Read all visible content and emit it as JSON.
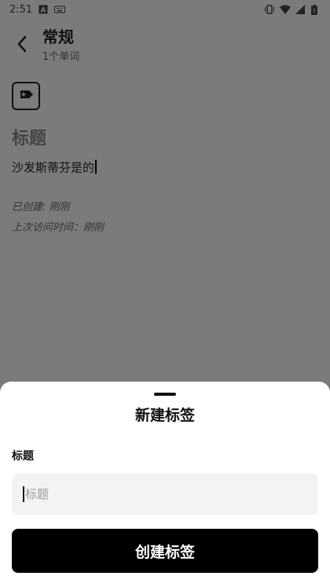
{
  "status_bar": {
    "time": "2:51",
    "icons": [
      "notification-a-icon",
      "keyboard-icon",
      "vibrate-icon",
      "wifi-icon",
      "signal-icon",
      "battery-icon"
    ]
  },
  "header": {
    "title": "常规",
    "subtitle": "1个单词",
    "back_icon": "back-chevron-icon"
  },
  "note": {
    "icon": "note-type-icon",
    "title": "标题",
    "body": "沙发斯蒂芬是的",
    "created": "已创建: 刚刚",
    "last_visited": "上次访问时间：刚刚"
  },
  "sheet": {
    "title": "新建标签",
    "field_label": "标题",
    "input_placeholder": "标题",
    "input_value": "",
    "primary_button": "创建标签"
  },
  "colors": {
    "overlay": "#7b7b7b",
    "sheet_bg": "#ffffff",
    "input_bg": "#f3f3f3",
    "button_bg": "#000000",
    "button_text": "#ffffff"
  }
}
